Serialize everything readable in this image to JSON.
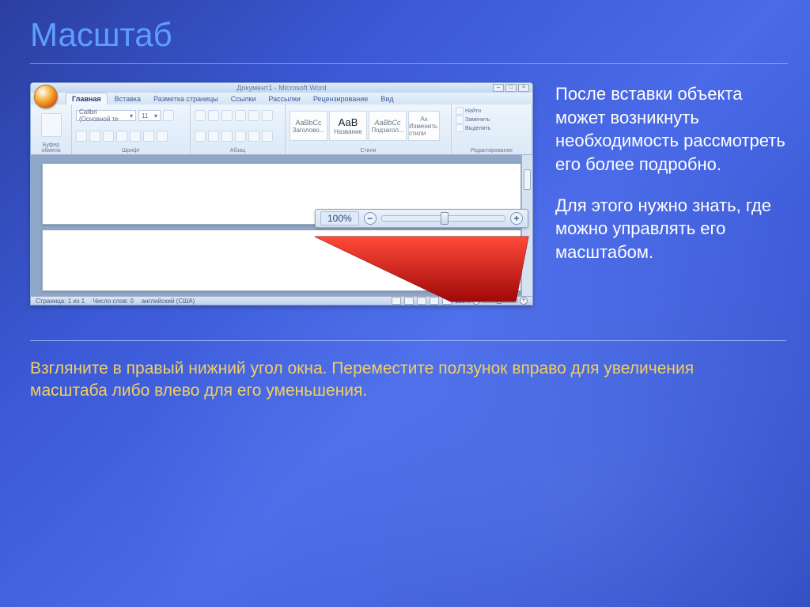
{
  "slide": {
    "title": "Масштаб",
    "side_para1": "После вставки объекта может возникнуть необходимость рассмотреть его более подробно.",
    "side_para2": "Для этого нужно знать, где можно управлять его масштабом.",
    "bottom_para": "Взгляните в правый нижний угол окна. Переместите ползунок вправо для увеличения масштаба либо влево для его уменьшения."
  },
  "word": {
    "titlebar": "Документ1 - Microsoft Word",
    "tabs": {
      "home": "Главная",
      "insert": "Вставка",
      "layout": "Разметка страницы",
      "refs": "Ссылки",
      "mail": "Рассылки",
      "review": "Рецензирование",
      "view": "Вид"
    },
    "ribbon": {
      "paste": "Вставить",
      "clipboard": "Буфер обмена",
      "font_name": "Calibri (Основной те",
      "font_size": "11",
      "font": "Шрифт",
      "paragraph": "Абзац",
      "style_sample1": "AaBbCc",
      "style_sample2": "АаВ",
      "style_sample3": "AaBbCc",
      "style_label1": "Заголово...",
      "style_label2": "Название",
      "style_label3": "Подзагол...",
      "change_styles": "Изменить стили",
      "styles": "Стили",
      "find": "Найти",
      "replace": "Заменить",
      "select": "Выделить",
      "editing": "Редактирование"
    },
    "status": {
      "page": "Страница: 1 из 1",
      "words": "Число слов: 0",
      "lang": "английский (США)",
      "zoom_small": "110%"
    },
    "zoom_callout": {
      "percent": "100%",
      "minus": "−",
      "plus": "+"
    }
  }
}
